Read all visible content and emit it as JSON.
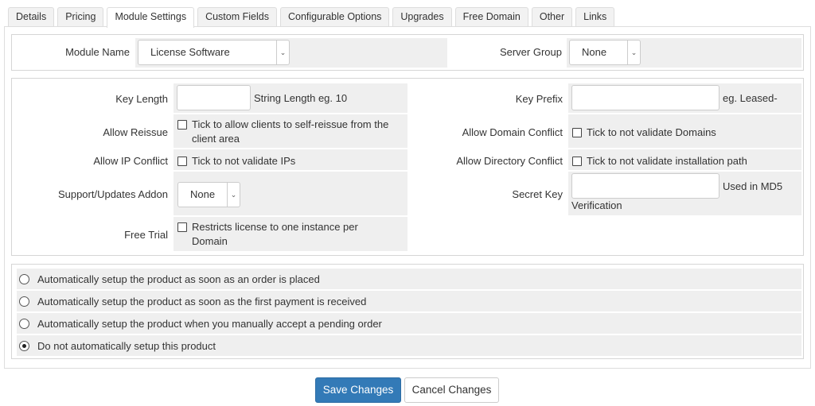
{
  "tabs": [
    {
      "label": "Details"
    },
    {
      "label": "Pricing"
    },
    {
      "label": "Module Settings",
      "active": true
    },
    {
      "label": "Custom Fields"
    },
    {
      "label": "Configurable Options"
    },
    {
      "label": "Upgrades"
    },
    {
      "label": "Free Domain"
    },
    {
      "label": "Other"
    },
    {
      "label": "Links"
    }
  ],
  "module": {
    "name_label": "Module Name",
    "name_value": "License Software",
    "server_group_label": "Server Group",
    "server_group_value": "None"
  },
  "settings": {
    "key_length_label": "Key Length",
    "key_length_value": "",
    "key_length_hint": "String Length eg. 10",
    "key_prefix_label": "Key Prefix",
    "key_prefix_value": "",
    "key_prefix_hint": "eg. Leased-",
    "allow_reissue_label": "Allow Reissue",
    "allow_reissue_text_1": "Tick to allow clients to self-reissue from the",
    "allow_reissue_text_2": "client area",
    "allow_domain_conflict_label": "Allow Domain Conflict",
    "allow_domain_conflict_text": "Tick to not validate Domains",
    "allow_ip_conflict_label": "Allow IP Conflict",
    "allow_ip_conflict_text": "Tick to not validate IPs",
    "allow_directory_conflict_label": "Allow Directory Conflict",
    "allow_directory_conflict_text": "Tick to not validate installation path",
    "support_addon_label": "Support/Updates Addon",
    "support_addon_value": "None",
    "secret_key_label": "Secret Key",
    "secret_key_value": "",
    "secret_key_hint_1": "Used in MD5",
    "secret_key_hint_2": "Verification",
    "free_trial_label": "Free Trial",
    "free_trial_text_1": "Restricts license to one instance per",
    "free_trial_text_2": "Domain"
  },
  "autosetup": {
    "options": [
      {
        "label": "Automatically setup the product as soon as an order is placed",
        "selected": false
      },
      {
        "label": "Automatically setup the product as soon as the first payment is received",
        "selected": false
      },
      {
        "label": "Automatically setup the product when you manually accept a pending order",
        "selected": false
      },
      {
        "label": "Do not automatically setup this product",
        "selected": true
      }
    ]
  },
  "buttons": {
    "save": "Save Changes",
    "cancel": "Cancel Changes"
  },
  "icons": {
    "select_caret": "chevron-down-icon"
  }
}
